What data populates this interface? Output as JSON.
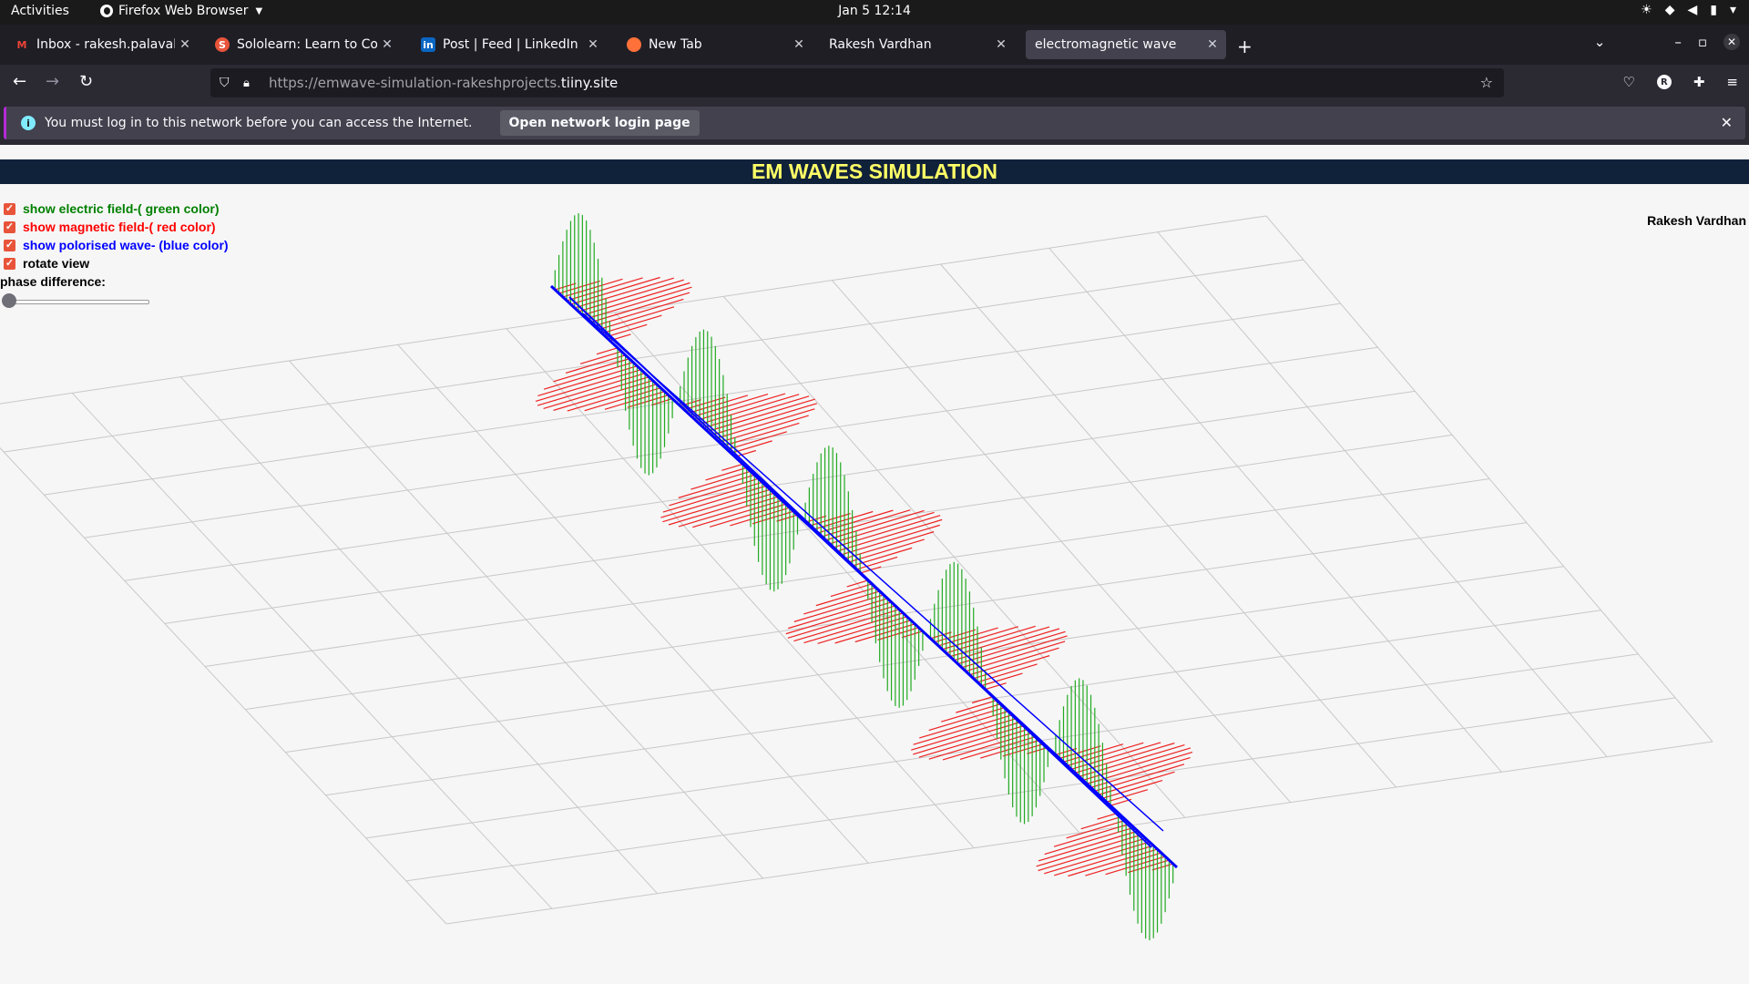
{
  "system_bar": {
    "activities": "Activities",
    "app_name": "Firefox Web Browser",
    "clock": "Jan 5  12:14"
  },
  "tabs": [
    {
      "title": "Inbox - rakesh.palavalasa",
      "icon": "gmail-icon",
      "active": false
    },
    {
      "title": "Sololearn: Learn to Code",
      "icon": "sololearn-icon",
      "active": false
    },
    {
      "title": "Post | Feed | LinkedIn",
      "icon": "linkedin-icon",
      "active": false
    },
    {
      "title": "New Tab",
      "icon": "firefox-icon",
      "active": false
    },
    {
      "title": "Rakesh Vardhan",
      "icon": "",
      "active": false
    },
    {
      "title": "electromagnetic wave",
      "icon": "",
      "active": true
    }
  ],
  "url": {
    "prefix": "https://emwave-simulation-rakeshprojects.",
    "domain": "tiiny.site"
  },
  "notification": {
    "message": "You must log in to this network before you can access the Internet.",
    "button": "Open network login page"
  },
  "page": {
    "title": "EM WAVES SIMULATION",
    "controls": [
      {
        "label": "show electric field-( green color)",
        "checked": true,
        "color": "#008000"
      },
      {
        "label": "show magnetic field-( red color)",
        "checked": true,
        "color": "#ff0000"
      },
      {
        "label": "show polorised wave- (blue color)",
        "checked": true,
        "color": "#0000ff"
      },
      {
        "label": "rotate view",
        "checked": true,
        "color": "#000000"
      }
    ],
    "phase_label": "phase difference:",
    "phase_value": 0,
    "author": "Rakesh Vardhan"
  },
  "colors": {
    "electric": "#22aa22",
    "magnetic": "#ee2222",
    "polarised": "#0000ff",
    "grid": "#c8c8c8",
    "title_bg": "#10213a",
    "title_fg": "#ffff66"
  }
}
